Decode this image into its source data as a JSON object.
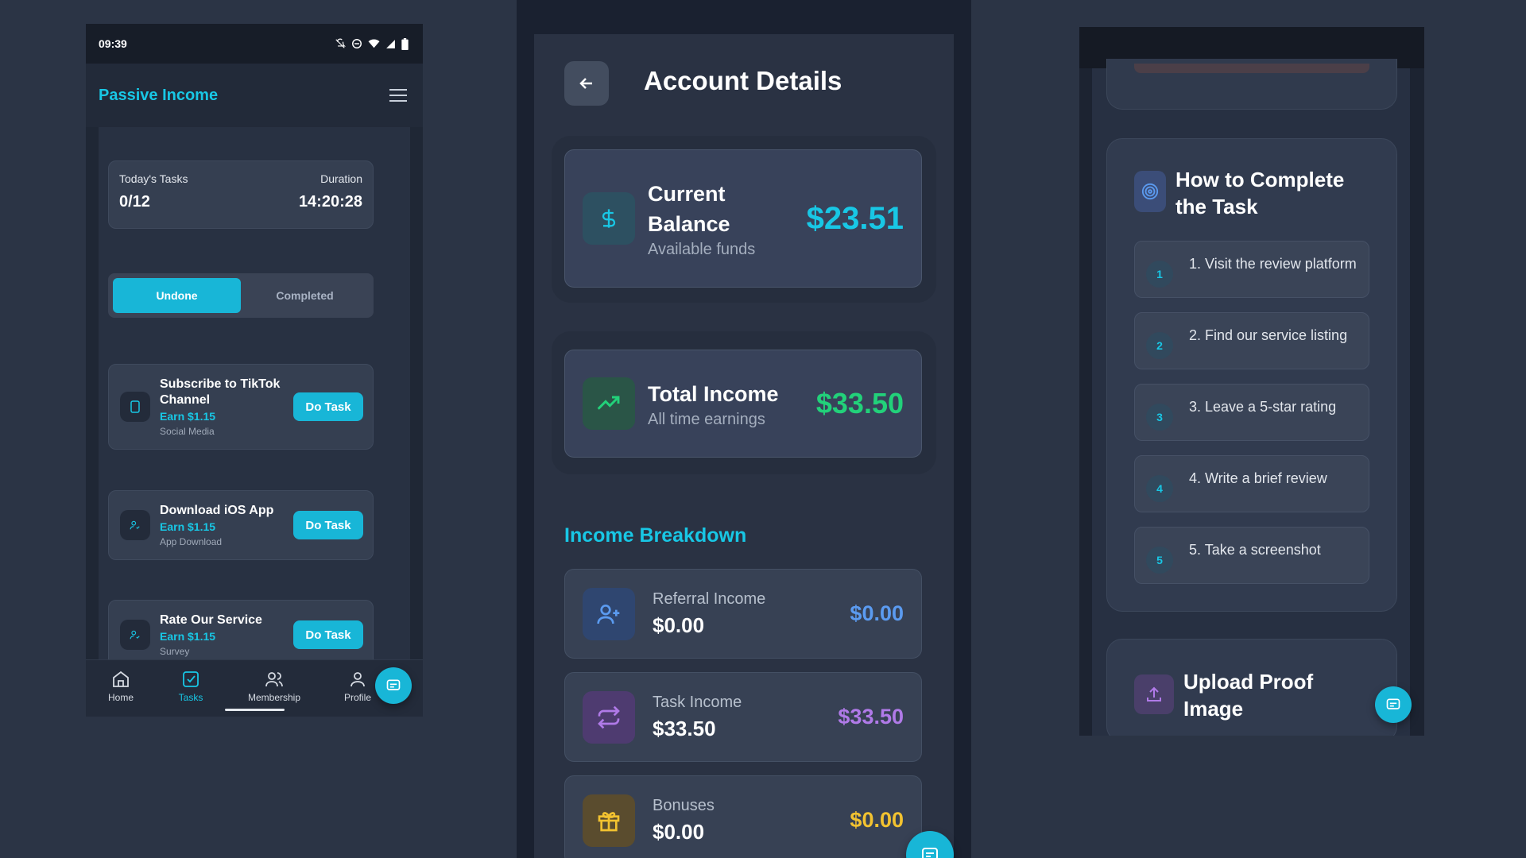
{
  "colors": {
    "accent": "#18c7e5",
    "green": "#22d17a",
    "blue": "#5b9bf0",
    "purple": "#b07ae8",
    "gold": "#f2c230"
  },
  "left": {
    "status_time": "09:39",
    "app_title": "Passive Income",
    "tasks_label": "Today's Tasks",
    "tasks_value": "0/12",
    "duration_label": "Duration",
    "duration_value": "14:20:28",
    "tabs": [
      "Undone",
      "Completed"
    ],
    "tasks": [
      {
        "name": "Subscribe to TikTok Channel",
        "earn": "Earn $1.15",
        "category": "Social Media",
        "button": "Do Task",
        "icon": "phone-icon"
      },
      {
        "name": "Download iOS App",
        "earn": "Earn $1.15",
        "category": "App Download",
        "button": "Do Task",
        "icon": "user-check-icon"
      },
      {
        "name": "Rate Our Service",
        "earn": "Earn $1.15",
        "category": "Survey",
        "button": "Do Task",
        "icon": "user-check-icon"
      }
    ],
    "nav": [
      "Home",
      "Tasks",
      "Membership",
      "Profile"
    ]
  },
  "middle": {
    "title": "Account Details",
    "balance": {
      "label": "Current Balance",
      "sub": "Available funds",
      "value": "$23.51",
      "icon": "dollar-icon"
    },
    "income": {
      "label": "Total Income",
      "sub": "All time earnings",
      "value": "$33.50",
      "icon": "trending-up-icon"
    },
    "breakdown_title": "Income Breakdown",
    "breakdown": [
      {
        "label": "Referral Income",
        "amount": "$0.00",
        "value": "$0.00",
        "icon": "user-plus-icon"
      },
      {
        "label": "Task Income",
        "amount": "$33.50",
        "value": "$33.50",
        "icon": "repeat-icon"
      },
      {
        "label": "Bonuses",
        "amount": "$0.00",
        "value": "$0.00",
        "icon": "gift-icon"
      }
    ]
  },
  "right": {
    "how_title": "How to Complete the Task",
    "steps": [
      {
        "num": "1",
        "text": "1. Visit the review platform"
      },
      {
        "num": "2",
        "text": "2. Find our service listing"
      },
      {
        "num": "3",
        "text": "3. Leave a 5-star rating"
      },
      {
        "num": "4",
        "text": "4. Write a brief review"
      },
      {
        "num": "5",
        "text": "5. Take a screenshot"
      }
    ],
    "upload_title": "Upload Proof Image"
  }
}
